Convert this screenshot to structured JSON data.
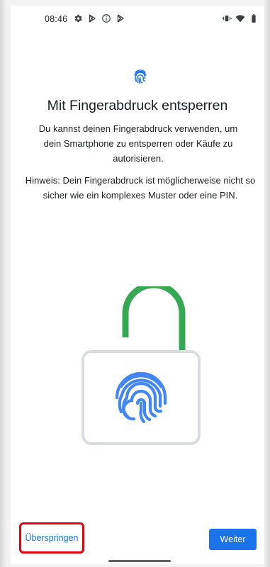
{
  "status_bar": {
    "time": "08:46",
    "left_icons": [
      "settings-icon",
      "play-store-icon",
      "info-icon",
      "play-store-icon"
    ],
    "right_icons": [
      "vibrate-icon",
      "wifi-icon",
      "battery-icon"
    ]
  },
  "header": {
    "icon": "fingerprint-icon",
    "title": "Mit Fingerabdruck entsperren"
  },
  "body": {
    "description": "Du kannst deinen Fingerabdruck verwenden, um dein Smartphone zu entsperren oder Käufe zu autorisieren.",
    "note": "Hinweis: Dein Fingerabdruck ist möglicherweise nicht so sicher wie ein komplexes Muster oder eine PIN."
  },
  "illustration": {
    "icons": [
      "open-padlock-icon",
      "fingerprint-icon"
    ],
    "colors": {
      "shackle": "#34a853",
      "lock_body": "#dadce0",
      "fingerprint": "#4285f4"
    }
  },
  "actions": {
    "skip_label": "Überspringen",
    "next_label": "Weiter"
  },
  "colors": {
    "accent": "#1a73e8",
    "highlight_border": "#e3000f"
  }
}
